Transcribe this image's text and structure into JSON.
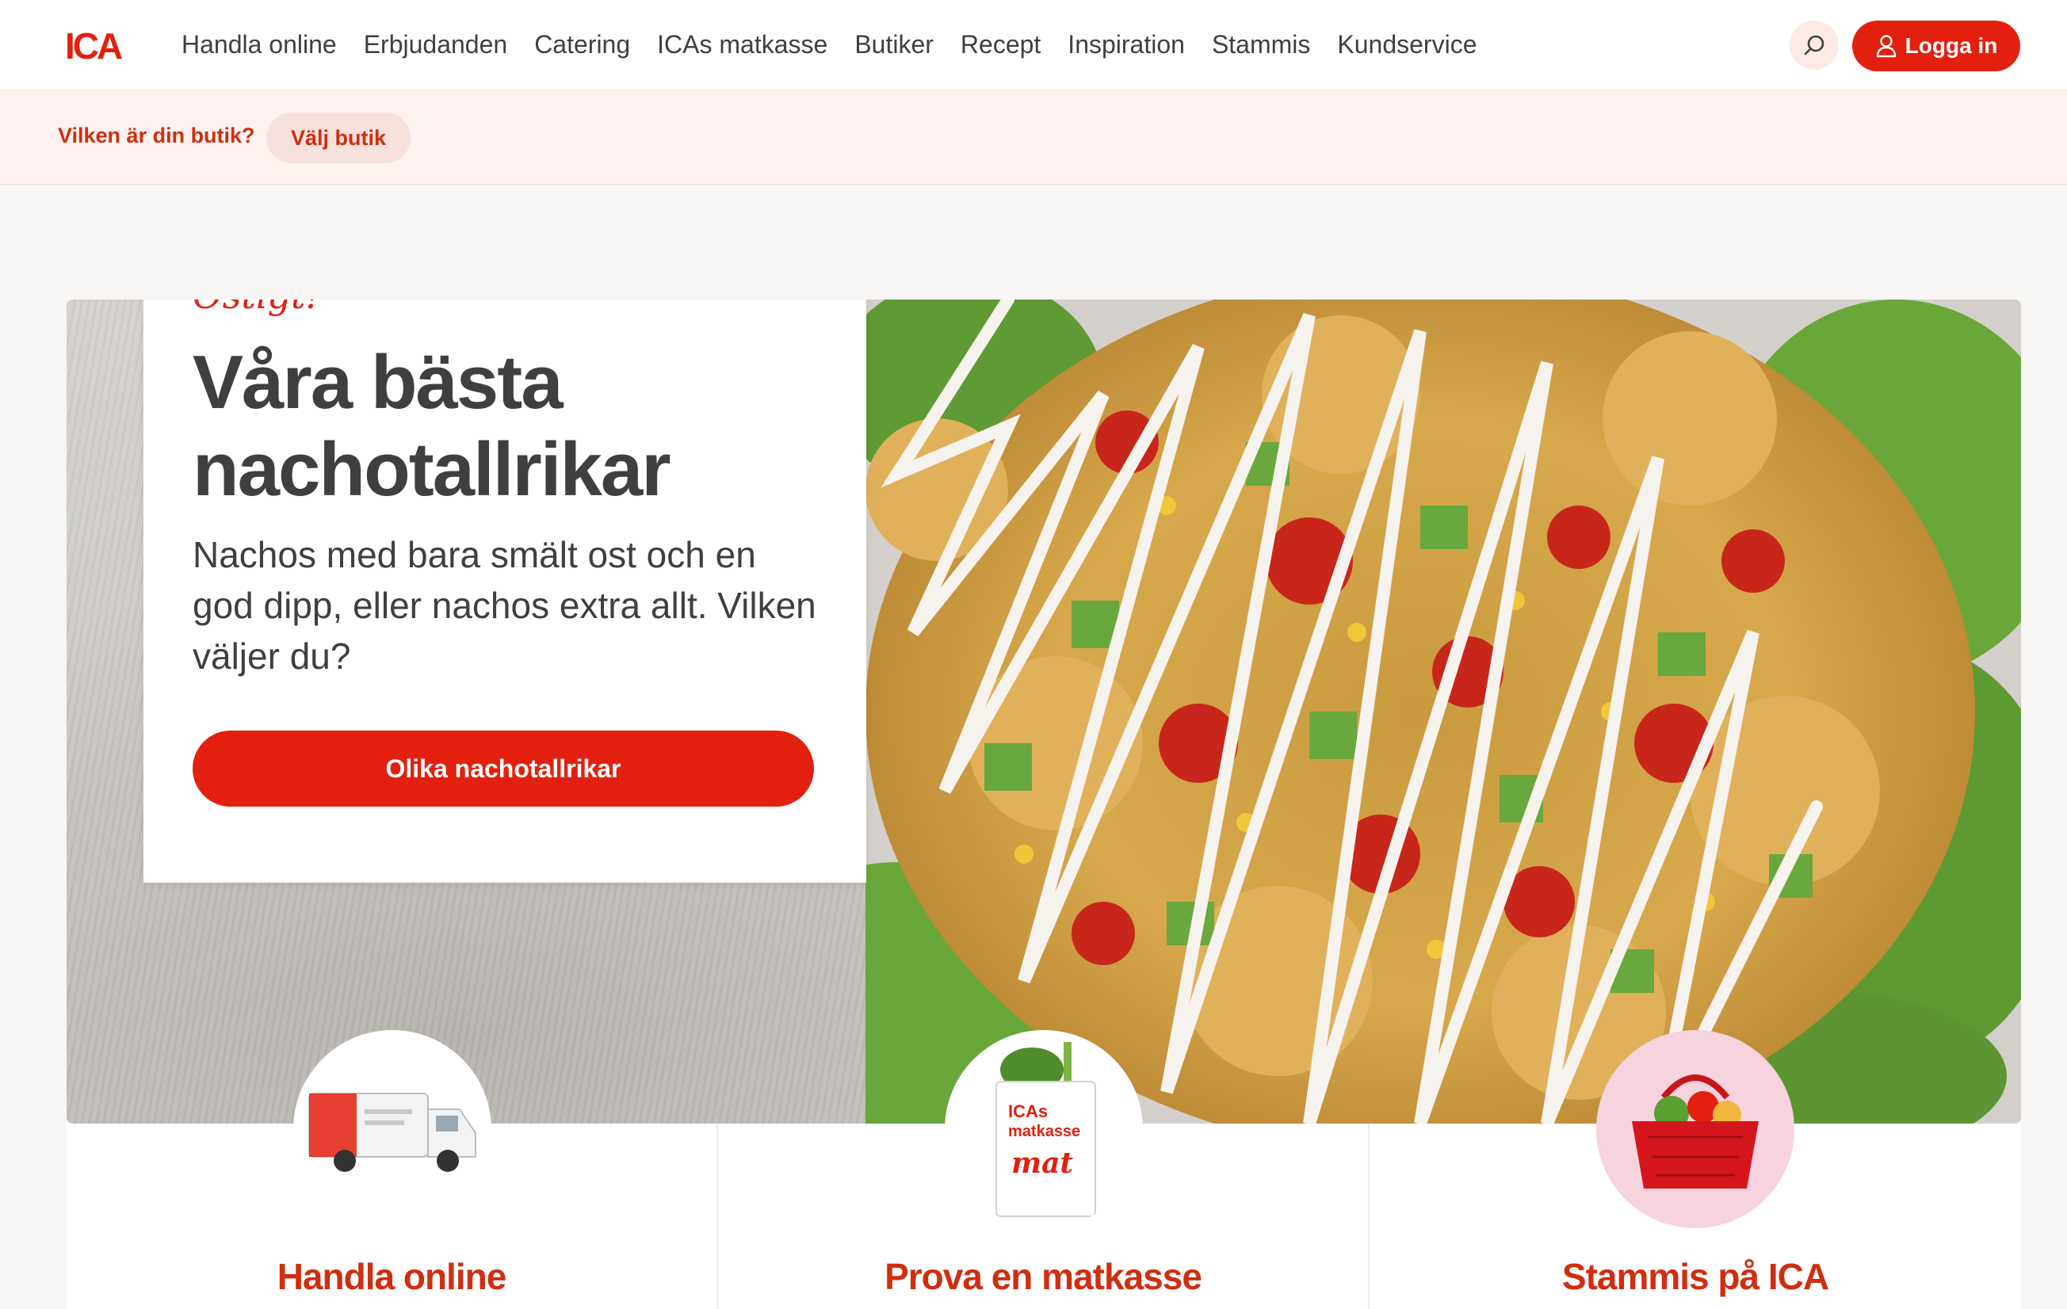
{
  "header": {
    "logo_text": "ICA",
    "nav": [
      "Handla online",
      "Erbjudanden",
      "Catering",
      "ICAs matkasse",
      "Butiker",
      "Recept",
      "Inspiration",
      "Stammis",
      "Kundservice"
    ],
    "login_label": "Logga in"
  },
  "store": {
    "question": "Vilken är din butik?",
    "choose_label": "Välj butik"
  },
  "hero": {
    "kicker": "Ostigt!",
    "title": "Våra bästa nachotallrikar",
    "text": "Nachos med bara smält ost och en god dipp, eller nachos extra allt. Vilken väljer du?",
    "cta": "Olika nachotallrikar"
  },
  "tiles": [
    {
      "title": "Handla online"
    },
    {
      "title": "Prova en matkasse"
    },
    {
      "title": "Stammis på ICA"
    }
  ],
  "colors": {
    "brand_red": "#e3200f",
    "dark_text": "#3f3f40",
    "store_bar_bg": "#fdf2ef"
  }
}
